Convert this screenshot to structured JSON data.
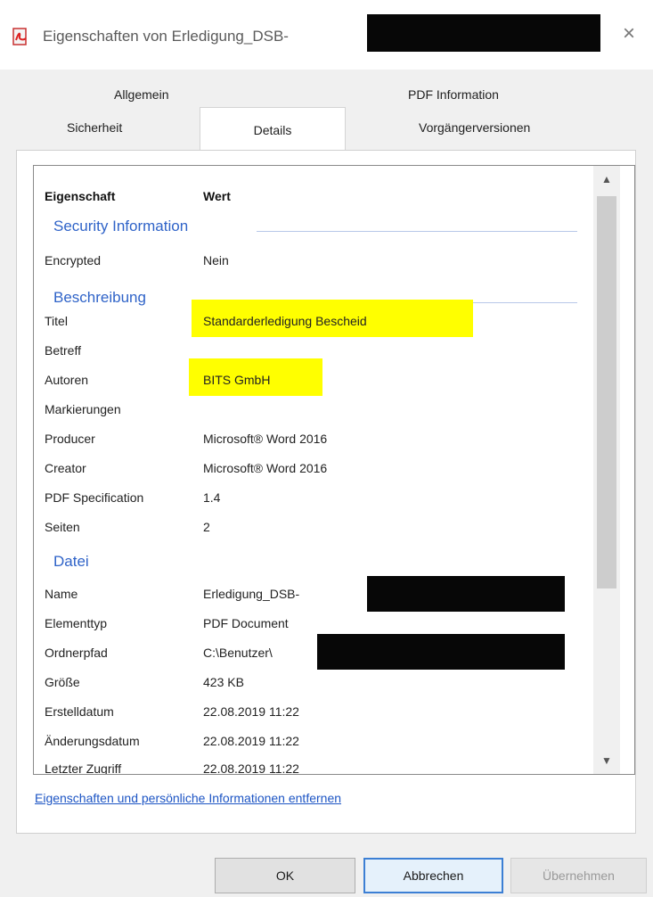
{
  "window": {
    "title": "Eigenschaften von Erledigung_DSB-",
    "close_label": "×"
  },
  "tabs": {
    "allgemein": "Allgemein",
    "pdf_information": "PDF Information",
    "sicherheit": "Sicherheit",
    "details": "Details",
    "vorgaengerversionen": "Vorgängerversionen"
  },
  "list": {
    "header": {
      "property": "Eigenschaft",
      "value": "Wert"
    },
    "groups": {
      "security": "Security Information",
      "beschreibung": "Beschreibung",
      "datei": "Datei"
    },
    "security_rows": [
      {
        "key": "Encrypted",
        "value": "Nein"
      }
    ],
    "beschreibung_rows": [
      {
        "key": "Titel",
        "value": "Standarderledigung Bescheid"
      },
      {
        "key": "Betreff",
        "value": ""
      },
      {
        "key": "Autoren",
        "value": "BITS GmbH"
      },
      {
        "key": "Markierungen",
        "value": ""
      },
      {
        "key": "Producer",
        "value": "Microsoft® Word 2016"
      },
      {
        "key": "Creator",
        "value": "Microsoft® Word 2016"
      },
      {
        "key": "PDF Specification",
        "value": "1.4"
      },
      {
        "key": "Seiten",
        "value": "2"
      }
    ],
    "datei_rows": [
      {
        "key": "Name",
        "value": "Erledigung_DSB-"
      },
      {
        "key": "Elementtyp",
        "value": "PDF Document"
      },
      {
        "key": "Ordnerpfad",
        "value": "C:\\Benutzer\\"
      },
      {
        "key": "Größe",
        "value": "423 KB"
      },
      {
        "key": "Erstelldatum",
        "value": "22.08.2019 11:22"
      },
      {
        "key": "Änderungsdatum",
        "value": "22.08.2019 11:22"
      },
      {
        "key": "Letzter Zugriff",
        "value": "22.08.2019 11:22"
      }
    ]
  },
  "link": {
    "remove_properties": "Eigenschaften und persönliche Informationen entfernen"
  },
  "buttons": {
    "ok": "OK",
    "cancel": "Abbrechen",
    "apply": "Übernehmen"
  },
  "colors": {
    "highlight": "#ffff00",
    "group_heading": "#2f63c8",
    "link": "#1d55c4"
  }
}
